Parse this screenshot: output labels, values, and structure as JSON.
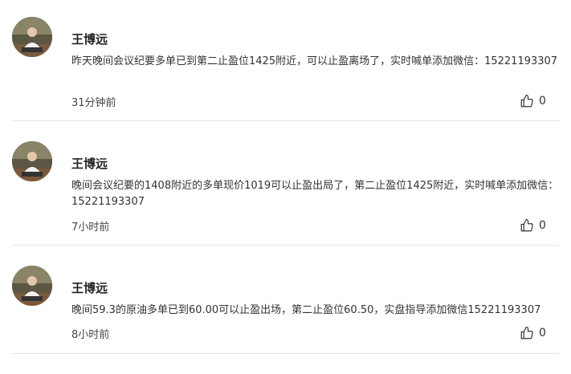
{
  "comments": [
    {
      "author": "王博远",
      "content": "昨天晚间会议纪要多单已到第二止盈位1425附近，可以止盈离场了，实时喊单添加微信：15221193307",
      "time": "31分钟前",
      "likes": "0",
      "avatar_icon": "user-avatar-photo",
      "like_icon": "thumbs-up-icon"
    },
    {
      "author": "王博远",
      "content": "晚间会议纪要的1408附近的多单现价1019可以止盈出局了，第二止盈位1425附近，实时喊单添加微信：15221193307",
      "time": "7小时前",
      "likes": "0",
      "avatar_icon": "user-avatar-photo",
      "like_icon": "thumbs-up-icon"
    },
    {
      "author": "王博远",
      "content": "晚间59.3的原油多单已到60.00可以止盈出场，第二止盈位60.50，实盘指导添加微信15221193307",
      "time": "8小时前",
      "likes": "0",
      "avatar_icon": "user-avatar-photo",
      "like_icon": "thumbs-up-icon"
    }
  ],
  "colors": {
    "author": "#222222",
    "content": "#333333",
    "divider": "#e6e6e6"
  }
}
